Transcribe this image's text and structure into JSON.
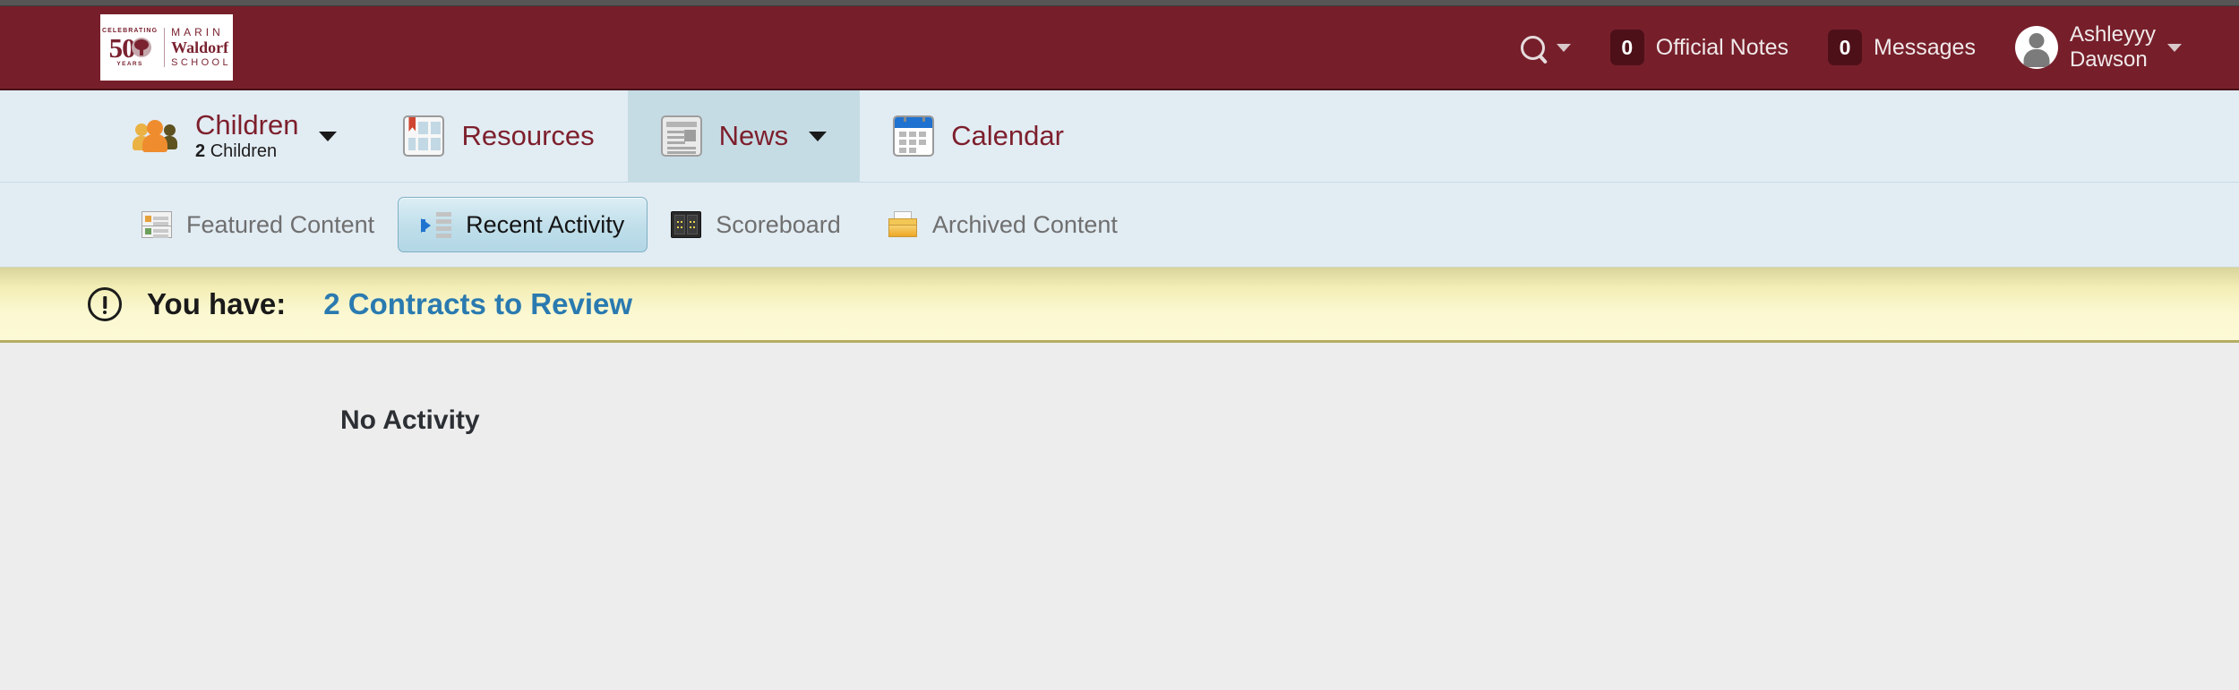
{
  "header": {
    "logo": {
      "celebrating": "CELEBRATING",
      "fifty": "50",
      "years": "YEARS",
      "line1": "MARIN",
      "line2": "Waldorf",
      "line3": "SCHOOL"
    },
    "search_icon": "search-icon",
    "official_notes": {
      "count": "0",
      "label": "Official Notes"
    },
    "messages": {
      "count": "0",
      "label": "Messages"
    },
    "user": {
      "name_line1": "Ashleyyy",
      "name_line2": "Dawson"
    },
    "colors": {
      "bar": "#761f2a",
      "badge": "#4d1019",
      "text": "#f0e9ea"
    }
  },
  "mainnav": {
    "items": [
      {
        "label": "Children",
        "sub_count": "2",
        "sub_label": "Children",
        "icon": "people-icon",
        "has_caret": true,
        "active": false
      },
      {
        "label": "Resources",
        "icon": "resources-icon",
        "has_caret": false,
        "active": false
      },
      {
        "label": "News",
        "icon": "news-icon",
        "has_caret": true,
        "active": true
      },
      {
        "label": "Calendar",
        "icon": "calendar-icon",
        "has_caret": false,
        "active": false
      }
    ],
    "colors": {
      "background": "#e2ecf3",
      "active_background": "#c6dce5",
      "label": "#7d1f2c"
    }
  },
  "subnav": {
    "items": [
      {
        "label": "Featured Content",
        "icon": "featured-content-icon",
        "active": false
      },
      {
        "label": "Recent Activity",
        "icon": "recent-activity-icon",
        "active": true
      },
      {
        "label": "Scoreboard",
        "icon": "scoreboard-icon",
        "active": false
      },
      {
        "label": "Archived Content",
        "icon": "archived-content-icon",
        "active": false
      }
    ]
  },
  "alert": {
    "icon": "exclamation-circle-icon",
    "prefix": "You have:",
    "link": "2 Contracts to Review",
    "colors": {
      "background": "#fbf8d2",
      "link": "#2a7ab0"
    }
  },
  "content": {
    "empty_message": "No Activity"
  }
}
